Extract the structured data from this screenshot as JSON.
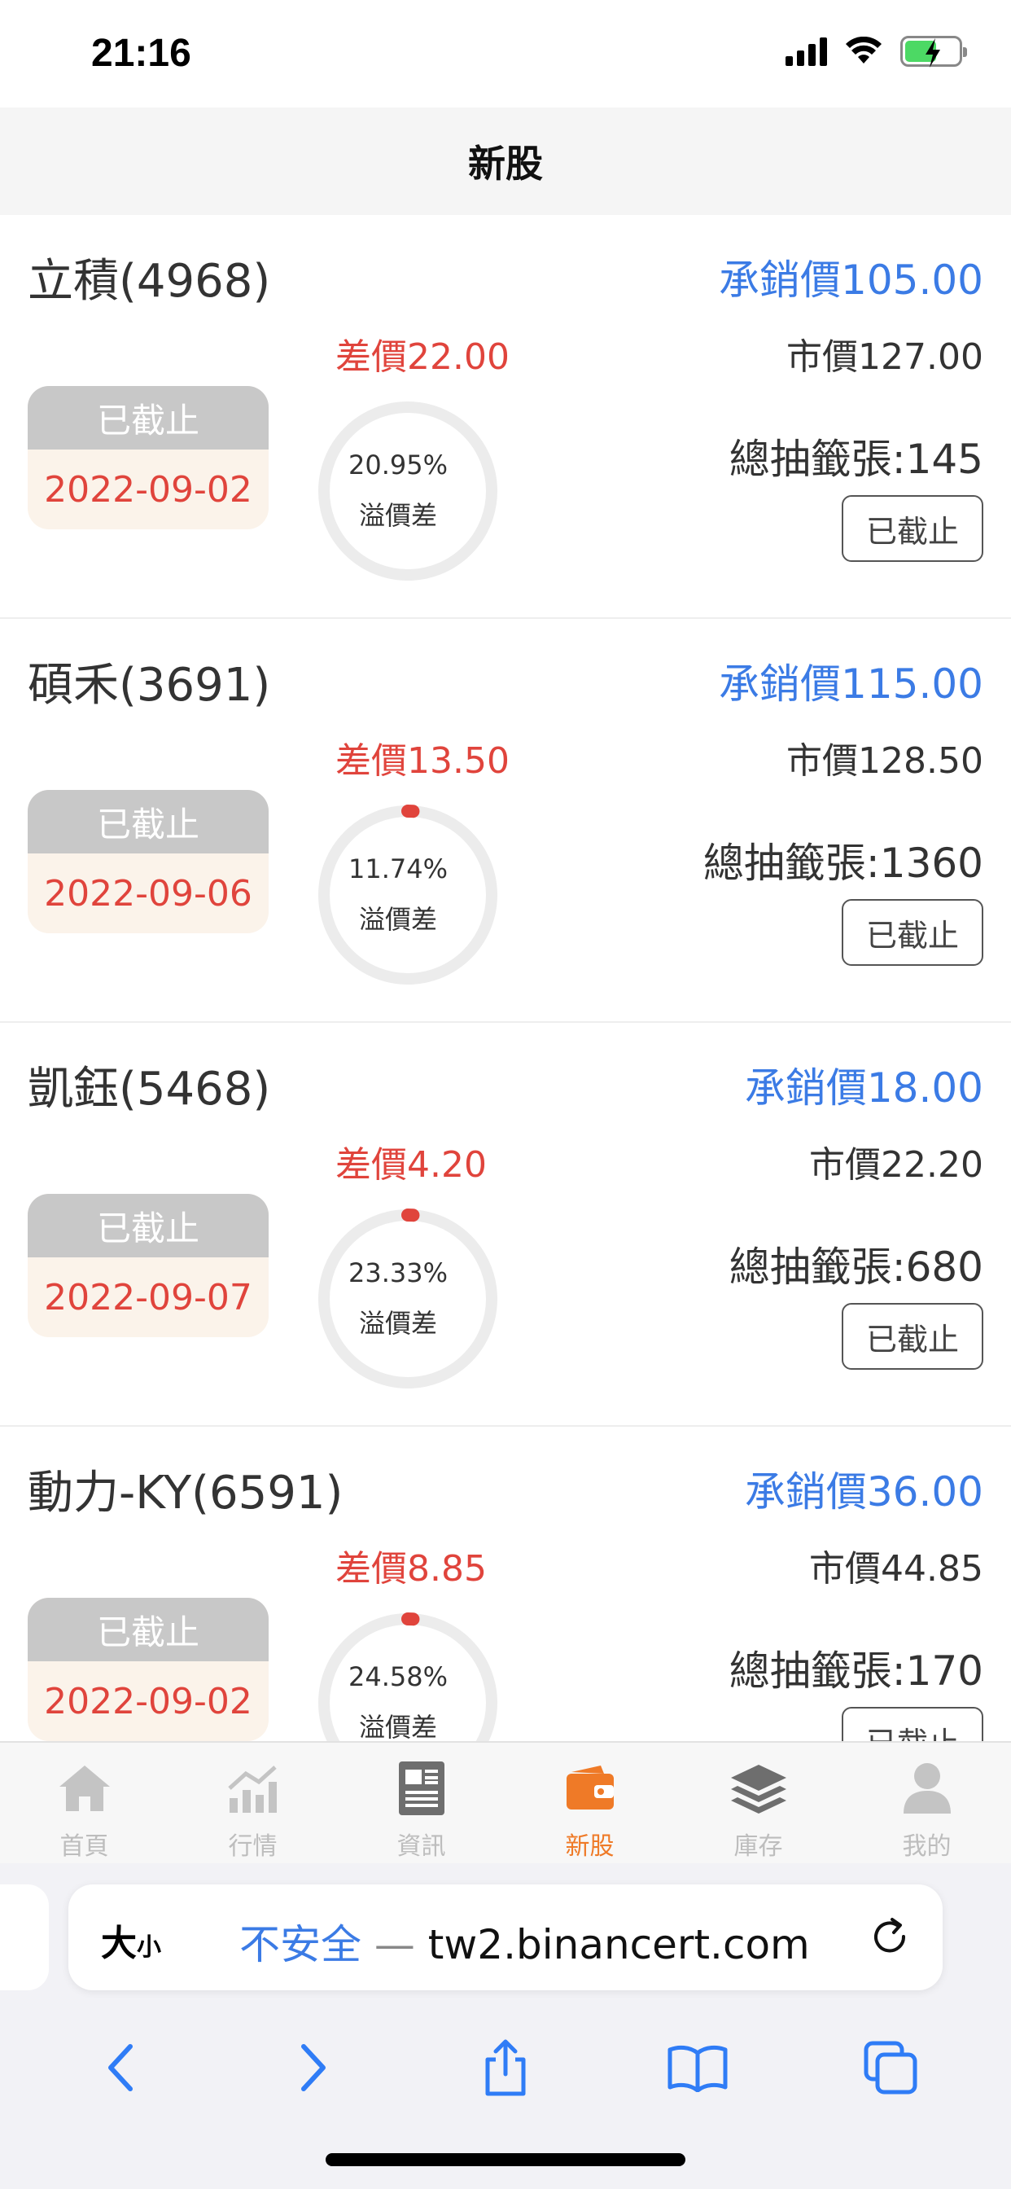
{
  "status_bar": {
    "time": "21:16"
  },
  "header": {
    "title": "新股"
  },
  "stocks": [
    {
      "name": "立積(4968)",
      "underwrite": "承銷價105.00",
      "diff": "差價22.00",
      "market": "市價127.00",
      "status_top": "已截止",
      "date": "2022-09-02",
      "pct": "20.95%",
      "pct_value": 20.95,
      "pct_label": "溢價差",
      "draw_total": "總抽籤張:145",
      "button": "已截止"
    },
    {
      "name": "碩禾(3691)",
      "underwrite": "承銷價115.00",
      "diff": "差價13.50",
      "market": "市價128.50",
      "status_top": "已截止",
      "date": "2022-09-06",
      "pct": "11.74%",
      "pct_value": 11.74,
      "pct_label": "溢價差",
      "draw_total": "總抽籤張:1360",
      "button": "已截止"
    },
    {
      "name": "凱鈺(5468)",
      "underwrite": "承銷價18.00",
      "diff": "差價4.20",
      "market": "市價22.20",
      "status_top": "已截止",
      "date": "2022-09-07",
      "pct": "23.33%",
      "pct_value": 23.33,
      "pct_label": "溢價差",
      "draw_total": "總抽籤張:680",
      "button": "已截止"
    },
    {
      "name": "動力-KY(6591)",
      "underwrite": "承銷價36.00",
      "diff": "差價8.85",
      "market": "市價44.85",
      "status_top": "已截止",
      "date": "2022-09-02",
      "pct": "24.58%",
      "pct_value": 24.58,
      "pct_label": "溢價差",
      "draw_total": "總抽籤張:170",
      "button": "已截止"
    }
  ],
  "tabs": [
    {
      "label": "首頁",
      "icon": "home-icon"
    },
    {
      "label": "行情",
      "icon": "chart-icon"
    },
    {
      "label": "資訊",
      "icon": "news-icon"
    },
    {
      "label": "新股",
      "icon": "wallet-icon",
      "active": true
    },
    {
      "label": "庫存",
      "icon": "layers-icon"
    },
    {
      "label": "我的",
      "icon": "user-icon"
    }
  ],
  "browser": {
    "text_size": "大",
    "text_size_small": "小",
    "insecure": "不安全",
    "separator": " — ",
    "domain": "tw2.binancert.com"
  },
  "colors": {
    "accent_blue": "#3b7be5",
    "accent_red": "#e0443c",
    "active_tab": "#ef7a27",
    "ring_track": "#ececec"
  }
}
